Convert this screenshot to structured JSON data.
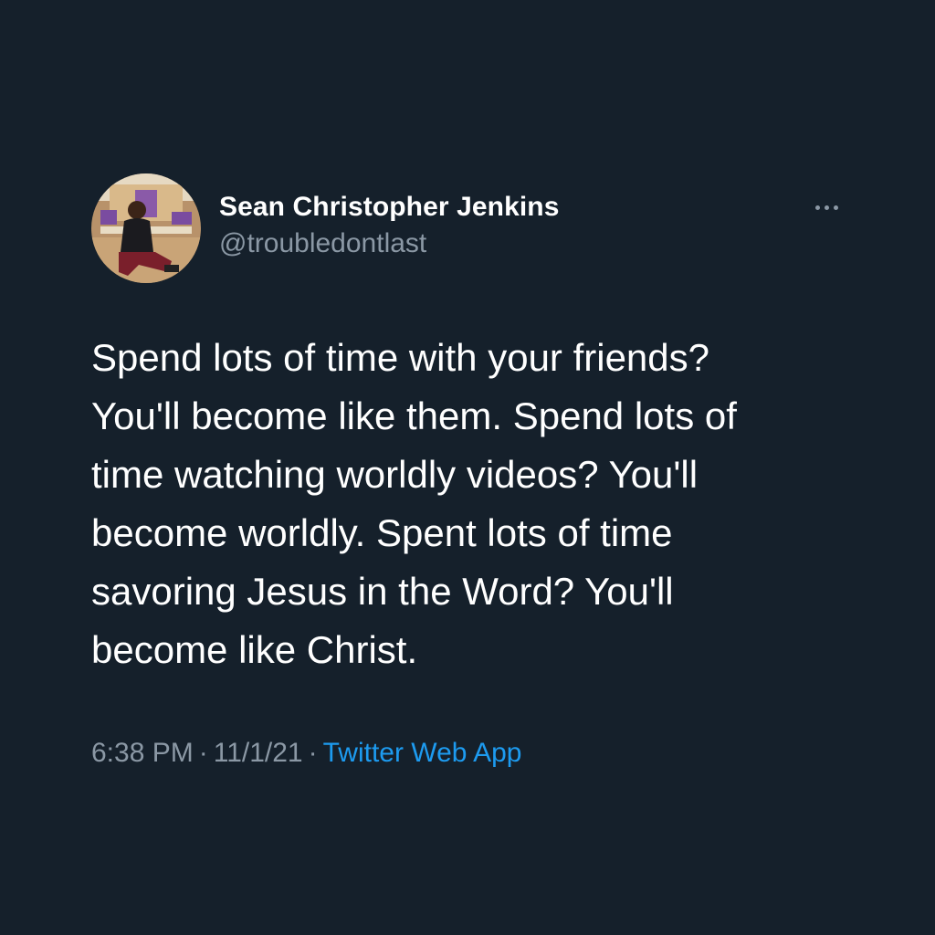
{
  "tweet": {
    "author": {
      "display_name": "Sean Christopher Jenkins",
      "handle": "@troubledontlast"
    },
    "more_icon": "more-horizontal-icon",
    "text_lines": [
      "Spend lots of time with your friends?",
      "You'll become like them. Spend lots of",
      "time watching worldly videos? You'll",
      "become worldly. Spent lots of time",
      "savoring Jesus in the Word? You'll",
      "become like Christ."
    ],
    "time": "6:38 PM",
    "separator": "·",
    "date": "11/1/21",
    "source": "Twitter Web App"
  },
  "colors": {
    "background": "#15202b",
    "text": "#ffffff",
    "secondary_text": "#8b98a5",
    "link": "#1d9bf0"
  }
}
